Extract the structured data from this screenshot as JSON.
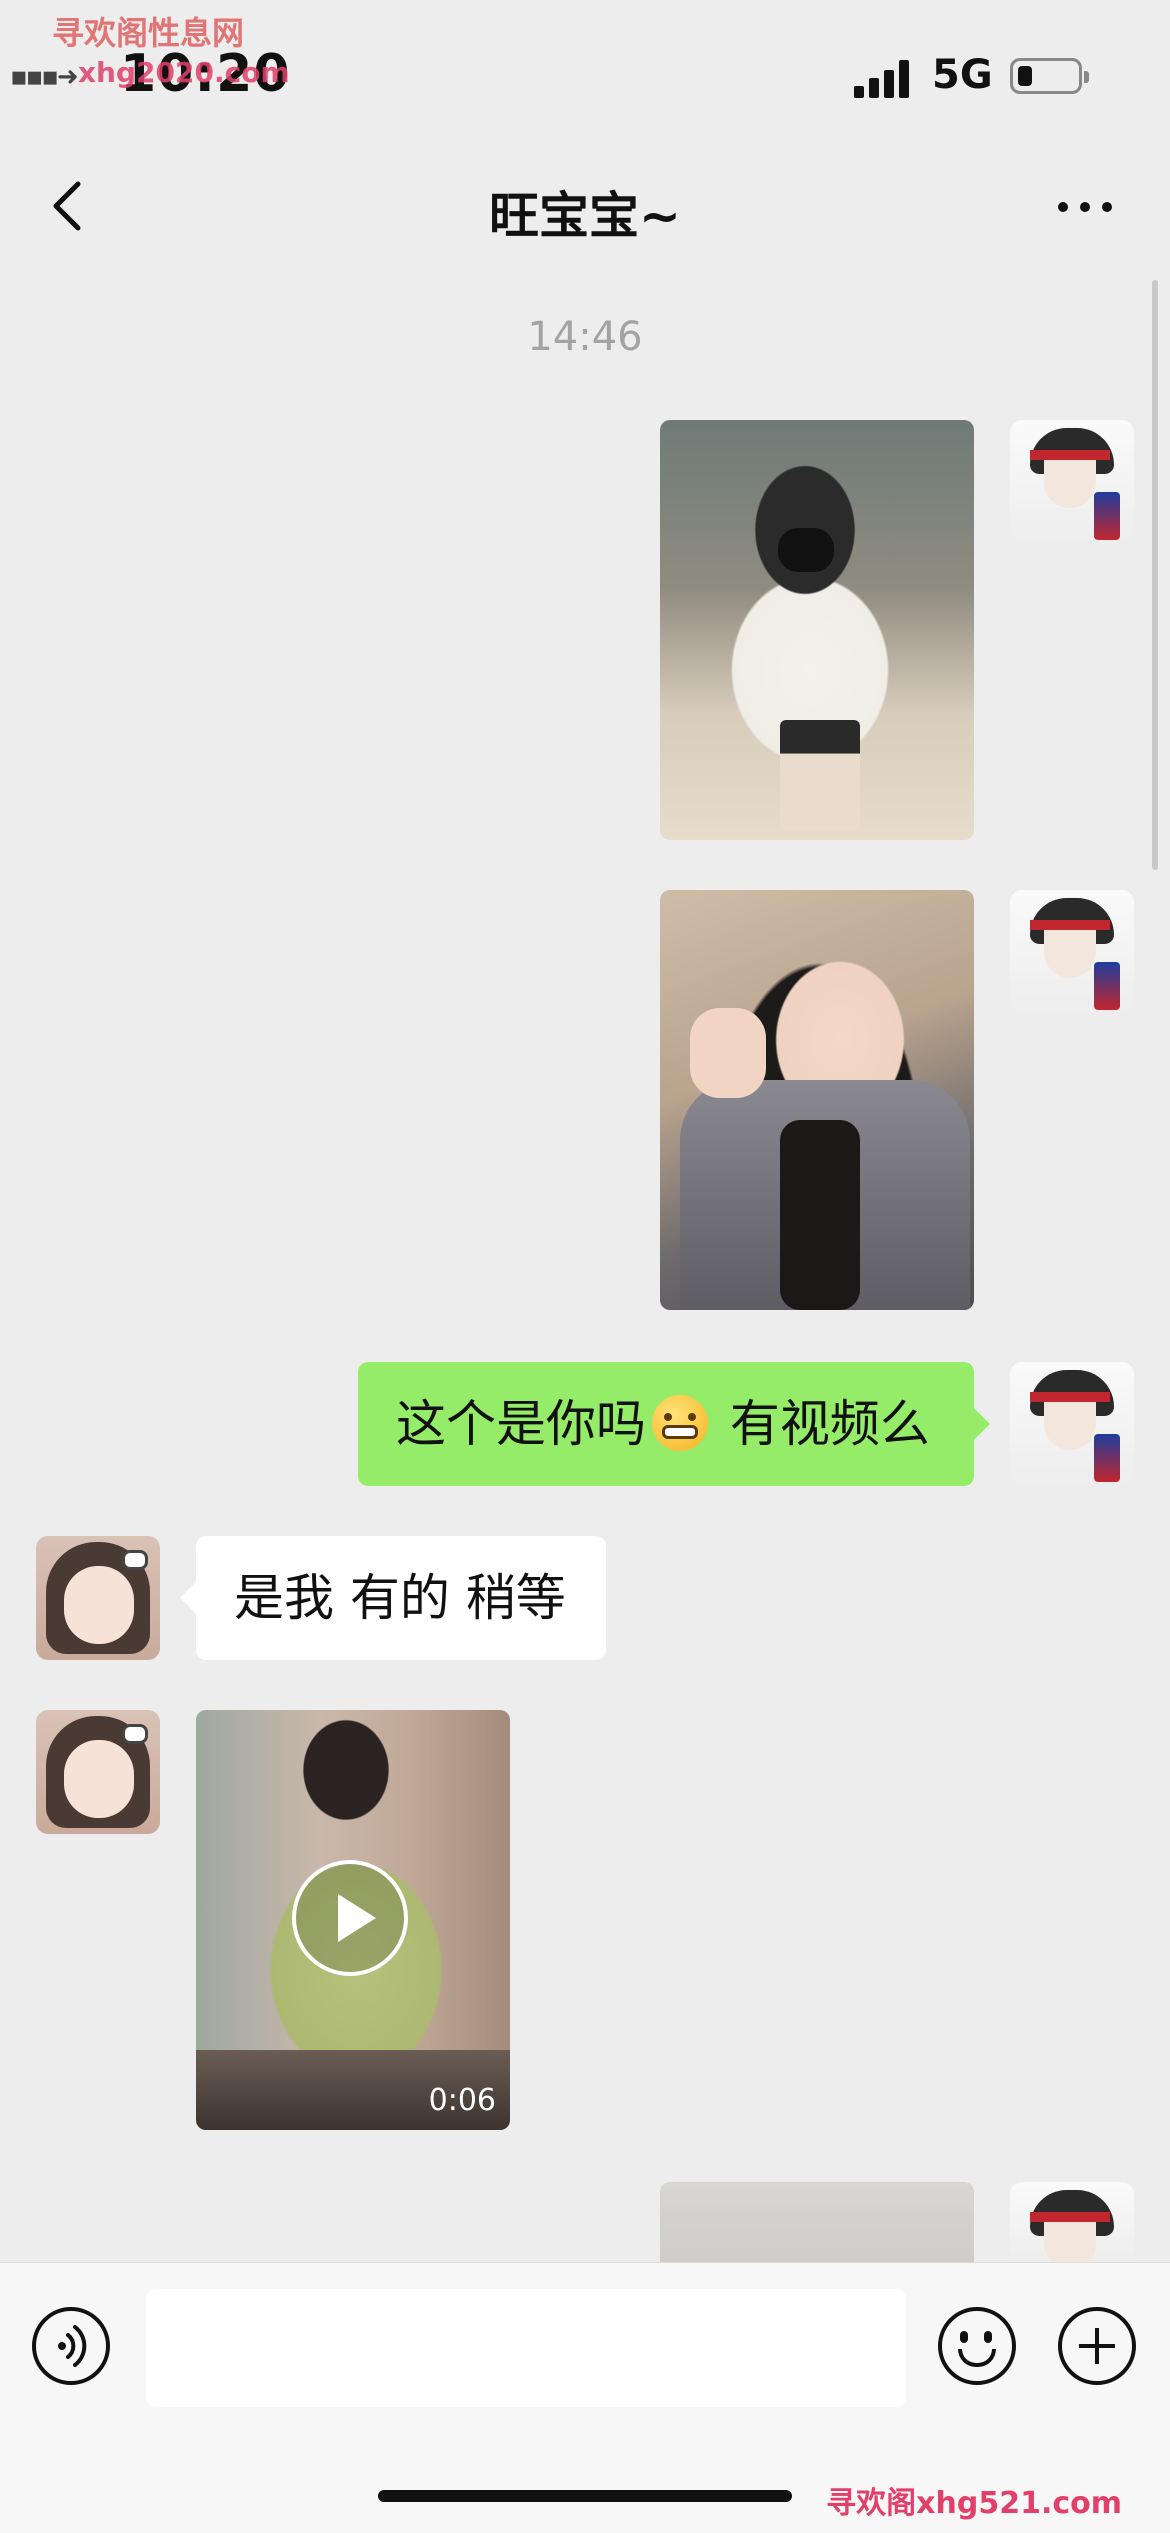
{
  "status_bar": {
    "time": "10:20",
    "network": "5G",
    "signal_bars": 4,
    "battery_level": 0.2
  },
  "watermarks": {
    "top_title": "寻欢阁性息网",
    "top_url": "xhg2020.com",
    "bottom": "寻欢阁xhg521.com"
  },
  "nav": {
    "title": "旺宝宝~",
    "back_icon": "chevron-left-icon",
    "more_icon": "more-dots-icon"
  },
  "chat": {
    "timestamp": "14:46",
    "messages": [
      {
        "sender": "me",
        "type": "image"
      },
      {
        "sender": "me",
        "type": "image"
      },
      {
        "sender": "me",
        "type": "text",
        "text_before": "这个是你吗",
        "emoji": "grimacing-face",
        "text_after": " 有视频么"
      },
      {
        "sender": "contact",
        "type": "text",
        "text": "是我 有的 稍等"
      },
      {
        "sender": "contact",
        "type": "video",
        "duration": "0:06"
      },
      {
        "sender": "me",
        "type": "image"
      }
    ]
  },
  "input_bar": {
    "voice_icon": "voice-icon",
    "input_value": "",
    "emoji_icon": "smiley-icon",
    "plus_icon": "plus-icon"
  },
  "colors": {
    "background": "#ededed",
    "my_bubble": "#95ec69",
    "their_bubble": "#ffffff",
    "timestamp": "#a3a3a3"
  }
}
